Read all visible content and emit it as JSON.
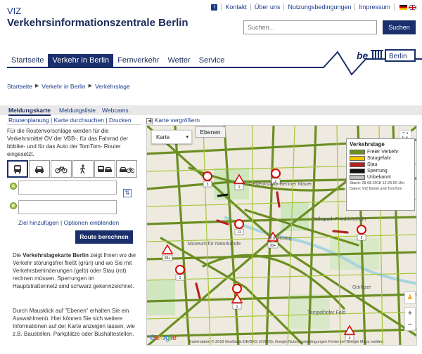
{
  "header": {
    "brand_small": "VIZ",
    "brand_big": "Verkehrsinformationszentrale Berlin",
    "links": [
      "Kontakt",
      "Über uns",
      "Nutzungsbedingungen",
      "Impressum"
    ],
    "search_placeholder": "Suchen...",
    "search_button": "Suchen",
    "logo_text": "be",
    "logo_city": "Berlin"
  },
  "nav": {
    "tabs": [
      "Startseite",
      "Verkehr in Berlin",
      "Fernverkehr",
      "Wetter",
      "Service"
    ],
    "active": "Verkehr in Berlin"
  },
  "breadcrumb": [
    "Startseite",
    "Verkehr in Berlin",
    "Verkehrslage"
  ],
  "subtabs": [
    "Meldungskarte",
    "Meldungsliste",
    "Webcams"
  ],
  "sublinks": [
    "Routenplanung",
    "Karte durchsuchen",
    "Drucken"
  ],
  "enlarge_label": "Karte vergrößern",
  "route": {
    "intro": "Für die Routenvorschläge werden für die Verkehrsmittel ÖV der VBB-, für das Fahrrad der bbbike- und für das Auto der TomTom- Router eingesetzt.",
    "modes": [
      "bus-icon",
      "car-icon",
      "bicycle-icon",
      "pedestrian-icon",
      "bus-car-icon",
      "car-bicycle-icon"
    ],
    "marker_a": "A",
    "marker_b": "B",
    "add_goal": "Ziel hinzufügen",
    "show_options": "Optionen einblenden",
    "calc_button": "Route berechnen"
  },
  "description": {
    "p1_pre": "Die ",
    "p1_bold": "Verkehrslagekarte Berlin",
    "p1_post": " zeigt Ihnen wo der Verkehr störungsfrei fließt (grün) und wo Sie mit Verkehrsbehinderungen (gelb) oder Stau (rot) rechnen müssen. Sperrungen im Hauptstraßennetz sind schwarz gekennzeichnet.",
    "p2": "Durch Mausklick auf \"Ebenen\" erhalten Sie ein Auswahlmenü. Hier können Sie sich weitere Informationen auf der Karte anzeigen lassen, wie z.B. Baustellen, Parkplätze oder Bushaltestellen."
  },
  "map": {
    "type_label": "Karte",
    "layers_label": "Ebenen",
    "legend_title": "Verkehrslage",
    "legend": [
      {
        "label": "Freier Verkehr",
        "color": "#6b8e23"
      },
      {
        "label": "Staugefahr",
        "color": "#f5c400"
      },
      {
        "label": "Stau",
        "color": "#b22222"
      },
      {
        "label": "Sperrung",
        "color": "#111111"
      },
      {
        "label": "Unbekannt",
        "color": "#bdbdbd"
      }
    ],
    "legend_stand": "Stand: 28.08.2018 12:26:00 Uhr",
    "legend_source": "Daten: VIZ Berlin und TomTom",
    "place_labels": [
      "Gedenkstätte Berliner Mauer",
      "Volkspark Friedrichshain",
      "Museum für Naturkunde",
      "Bundestag",
      "Tempelhofer Feld",
      "Görlitzer"
    ],
    "google": "Google",
    "attribution": "Kartendaten © 2018 GeoBasis-DE/BKG (©2009), Google  Nutzungsbedingungen  Fehler bei Google Maps melden",
    "sign_labels": [
      "3",
      "1",
      "2",
      "11",
      "20+",
      "1",
      "20+",
      "1",
      "5",
      "4"
    ]
  }
}
